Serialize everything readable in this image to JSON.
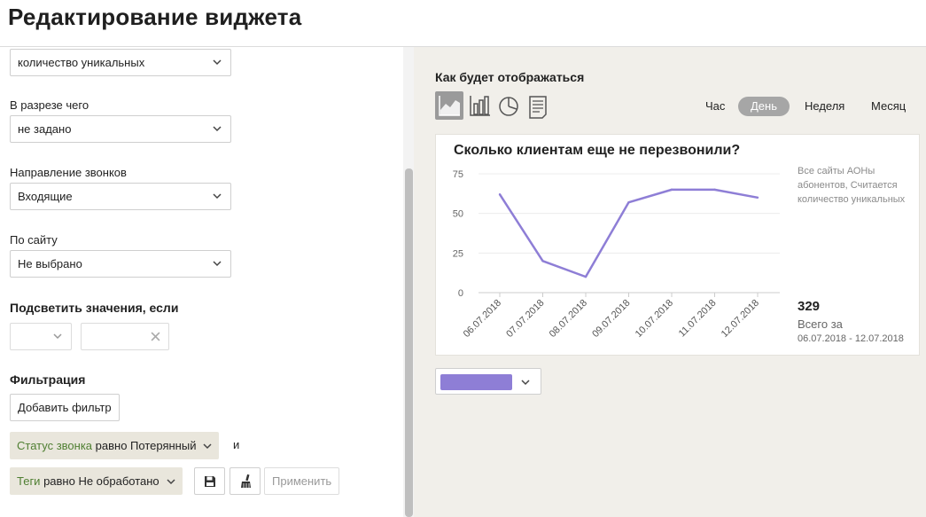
{
  "header": {
    "title": "Редактирование виджета"
  },
  "form": {
    "metric_select": {
      "value": "количество уникальных"
    },
    "breakdown": {
      "label": "В разрезе чего",
      "value": "не задано"
    },
    "direction": {
      "label": "Направление звонков",
      "value": "Входящие"
    },
    "site": {
      "label": "По сайту",
      "value": "Не выбрано"
    },
    "highlight": {
      "label": "Подсветить значения, если"
    },
    "filter": {
      "label": "Фильтрация",
      "add_button": "Добавить фильтр",
      "chips": [
        {
          "key": "Статус звонка",
          "rest": " равно Потерянный"
        },
        {
          "key": "Теги",
          "rest": " равно Не обработано"
        }
      ],
      "connector": "и",
      "apply_button": "Применить"
    }
  },
  "preview": {
    "title": "Как будет отображаться",
    "chart_types": [
      "line-chart-icon",
      "bar-chart-icon",
      "pie-chart-icon",
      "table-icon"
    ],
    "periods": [
      "Час",
      "День",
      "Неделя",
      "Месяц"
    ],
    "active_period": "День",
    "accent": "#8e7ed6"
  },
  "chart_data": {
    "type": "line",
    "title": "Сколько клиентам еще не перезвонили?",
    "x": [
      "06.07.2018",
      "07.07.2018",
      "08.07.2018",
      "09.07.2018",
      "10.07.2018",
      "11.07.2018",
      "12.07.2018"
    ],
    "series": [
      {
        "values": [
          62,
          20,
          10,
          57,
          65,
          65,
          60
        ]
      }
    ],
    "yticks": [
      "0",
      "25",
      "50",
      "75"
    ],
    "ylim": [
      0,
      75
    ],
    "grid": true,
    "note": "Все сайты АОНы абонентов, Считается количество уникальных",
    "total": "329",
    "total_label": "Всего за",
    "total_range": "06.07.2018 - 12.07.2018",
    "color": "#8e7ed6"
  }
}
